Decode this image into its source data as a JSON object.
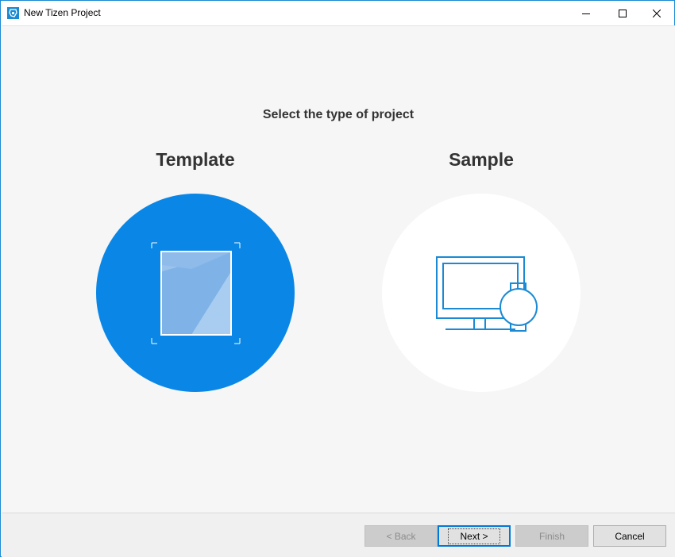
{
  "window": {
    "title": "New Tizen Project",
    "icon": "tizen-app-icon",
    "controls": [
      "minimize-icon",
      "maximize-icon",
      "close-icon"
    ]
  },
  "main": {
    "heading": "Select the type of project",
    "options": [
      {
        "label": "Template",
        "icon": "template-document-icon",
        "selected": true
      },
      {
        "label": "Sample",
        "icon": "monitor-watch-icon",
        "selected": false
      }
    ]
  },
  "footer": {
    "back_label": "< Back",
    "next_label": "Next >",
    "finish_label": "Finish",
    "cancel_label": "Cancel"
  },
  "colors": {
    "accent": "#0a87e6",
    "icon_stroke": "#1a8ad4",
    "background": "#f6f6f6"
  }
}
